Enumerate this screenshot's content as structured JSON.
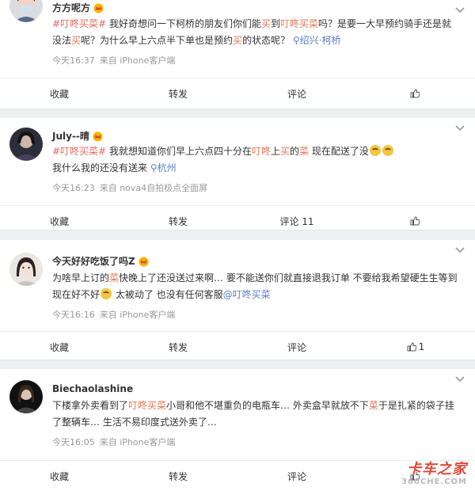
{
  "posts": [
    {
      "username": "方方呢方",
      "content": [
        {
          "t": "#叮咚买菜#",
          "c": "tag"
        },
        {
          "t": " 我好奇想问一下柯桥的朋友们你们能"
        },
        {
          "t": "买",
          "c": "hl"
        },
        {
          "t": "到"
        },
        {
          "t": "叮咚买菜",
          "c": "hl"
        },
        {
          "t": "吗？是要一大早预约骑手还是就没法"
        },
        {
          "t": "买",
          "c": "hl"
        },
        {
          "t": "呢？为什么早上六点半下单也是预约"
        },
        {
          "t": "买",
          "c": "hl"
        },
        {
          "t": "的状态呢？ "
        },
        {
          "t": "⚲绍兴·柯桥",
          "c": "lk"
        }
      ],
      "time": "今天16:37",
      "source": "来自 iPhone客户端",
      "actions": {
        "collect": "收藏",
        "repost": "转发",
        "comment": "评论",
        "like": ""
      }
    },
    {
      "username": "July--晴",
      "content": [
        {
          "t": "#叮咚买菜#",
          "c": "tag"
        },
        {
          "t": " 我就想知道你们早上六点四十分在"
        },
        {
          "t": "叮咚",
          "c": "hl"
        },
        {
          "t": "上"
        },
        {
          "t": "买",
          "c": "hl"
        },
        {
          "t": "的"
        },
        {
          "t": "菜",
          "c": "hl"
        },
        {
          "t": " 现在配送了没"
        },
        {
          "e": 1
        },
        {
          "e": 1
        },
        {
          "br": 1
        },
        {
          "t": "我什么我的还没有送来 "
        },
        {
          "t": "⚲杭州",
          "c": "lk"
        }
      ],
      "time": "今天16:23",
      "source": "来自 nova4自拍极点全面屏",
      "actions": {
        "collect": "收藏",
        "repost": "转发",
        "comment": "评论 11",
        "like": ""
      }
    },
    {
      "username": "今天好好吃饭了吗Z",
      "content": [
        {
          "t": "为啥早上订的"
        },
        {
          "t": "菜",
          "c": "hl"
        },
        {
          "t": "快晚上了还没送过来啊… 要不能送你们就直接退我订单 不要给我希望硬生生等到现在好不好"
        },
        {
          "e": 1
        },
        {
          "t": " 太被动了 也没有任何客服"
        },
        {
          "t": "@叮咚买菜",
          "c": "lk"
        }
      ],
      "time": "今天16:16",
      "source": "来自 iPhone客户端",
      "actions": {
        "collect": "收藏",
        "repost": "转发",
        "comment": "评论",
        "like": "1"
      }
    },
    {
      "username": "Biechaolashine",
      "content": [
        {
          "t": "下楼拿外卖看到了"
        },
        {
          "t": "叮咚买菜",
          "c": "hl"
        },
        {
          "t": "小哥和他不堪重负的电瓶车… 外卖盒早就放不下"
        },
        {
          "t": "菜",
          "c": "hl"
        },
        {
          "t": "于是扎紧的袋子挂了整辆车… 生活不易印度式送外卖了…"
        }
      ],
      "time": "今天16:05",
      "source": "来自 iPhone客户端",
      "actions": {
        "collect": "收藏",
        "repost": "转发",
        "comment": "评论",
        "like": ""
      }
    }
  ],
  "watermark": {
    "main": "卡车之家",
    "sub": "360CHE.COM"
  },
  "colors": {
    "highlight": "#eb7350",
    "link": "#5d7cc6",
    "meta": "#999999"
  },
  "icons": {
    "expand": "chevron-down-icon",
    "like": "thumbs-up-icon",
    "verified": "vip-crown-icon",
    "location": "location-pin-icon"
  }
}
